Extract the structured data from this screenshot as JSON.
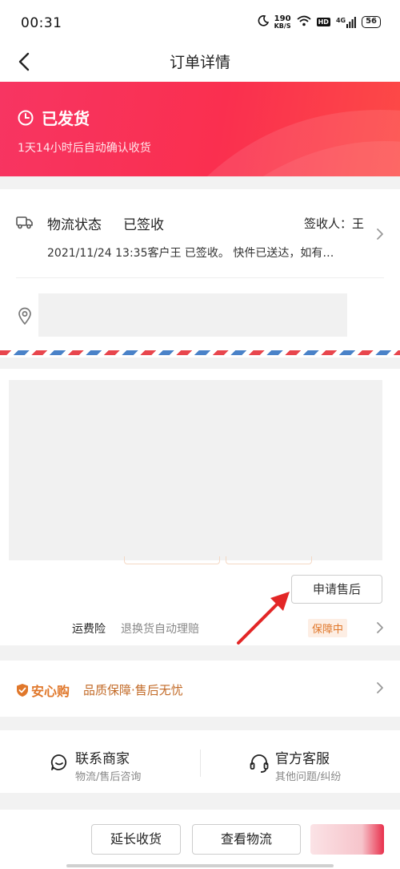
{
  "status_bar": {
    "time": "00:31",
    "net_speed_value": "190",
    "net_speed_unit": "KB/S",
    "hd": "HD",
    "net_type": "4G",
    "battery": "56"
  },
  "nav": {
    "title": "订单详情"
  },
  "banner": {
    "status": "已发货",
    "subtitle": "1天14小时后自动确认收货"
  },
  "logistics": {
    "label": "物流状态",
    "status": "已签收",
    "signer": "签收人：王",
    "detail": "2021/11/24 13:35客户王 已签收。 快件已送达，如有…"
  },
  "product": {
    "after_sale_button": "申请售后",
    "insurance_label": "运费险",
    "insurance_desc": "退换货自动理赔",
    "insurance_badge": "保障中"
  },
  "guarantee": {
    "logo": "安心购",
    "text": "品质保障·售后无忧"
  },
  "contact": {
    "merchant_title": "联系商家",
    "merchant_sub": "物流/售后咨询",
    "service_title": "官方客服",
    "service_sub": "其他问题/纠纷"
  },
  "bottom_bar": {
    "extend_button": "延长收货",
    "view_button": "查看物流"
  },
  "colors": {
    "banner_start": "#f73562",
    "banner_end": "#fd4a46",
    "accent_orange": "#e0772a",
    "annotation_red": "#e32626"
  }
}
